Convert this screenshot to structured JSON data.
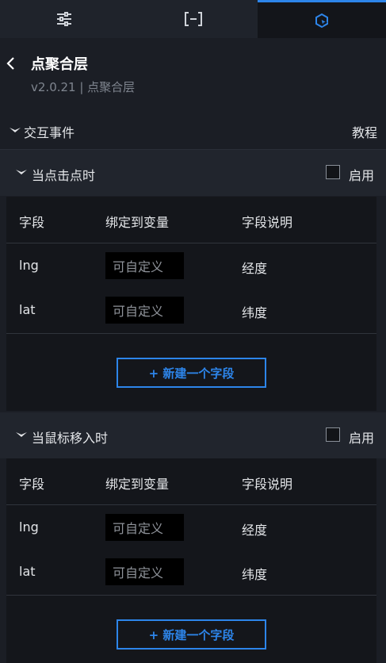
{
  "tabs": [
    {
      "icon": "sliders-icon"
    },
    {
      "icon": "bracket-icon"
    },
    {
      "icon": "interaction-icon"
    }
  ],
  "header": {
    "title": "点聚合层",
    "subtitle": "v2.0.21 | 点聚合层"
  },
  "section": {
    "label": "交互事件",
    "help": "教程"
  },
  "events": [
    {
      "label": "当点击点时",
      "enable_label": "启用",
      "columns": [
        "字段",
        "绑定到变量",
        "字段说明"
      ],
      "rows": [
        {
          "field": "lng",
          "placeholder": "可自定义",
          "desc": "经度"
        },
        {
          "field": "lat",
          "placeholder": "可自定义",
          "desc": "纬度"
        }
      ],
      "add_label": "+ 新建一个字段"
    },
    {
      "label": "当鼠标移入时",
      "enable_label": "启用",
      "columns": [
        "字段",
        "绑定到变量",
        "字段说明"
      ],
      "rows": [
        {
          "field": "lng",
          "placeholder": "可自定义",
          "desc": "经度"
        },
        {
          "field": "lat",
          "placeholder": "可自定义",
          "desc": "纬度"
        }
      ],
      "add_label": "+ 新建一个字段"
    }
  ],
  "colors": {
    "accent": "#2d85ea",
    "background": "#1b1e25"
  }
}
